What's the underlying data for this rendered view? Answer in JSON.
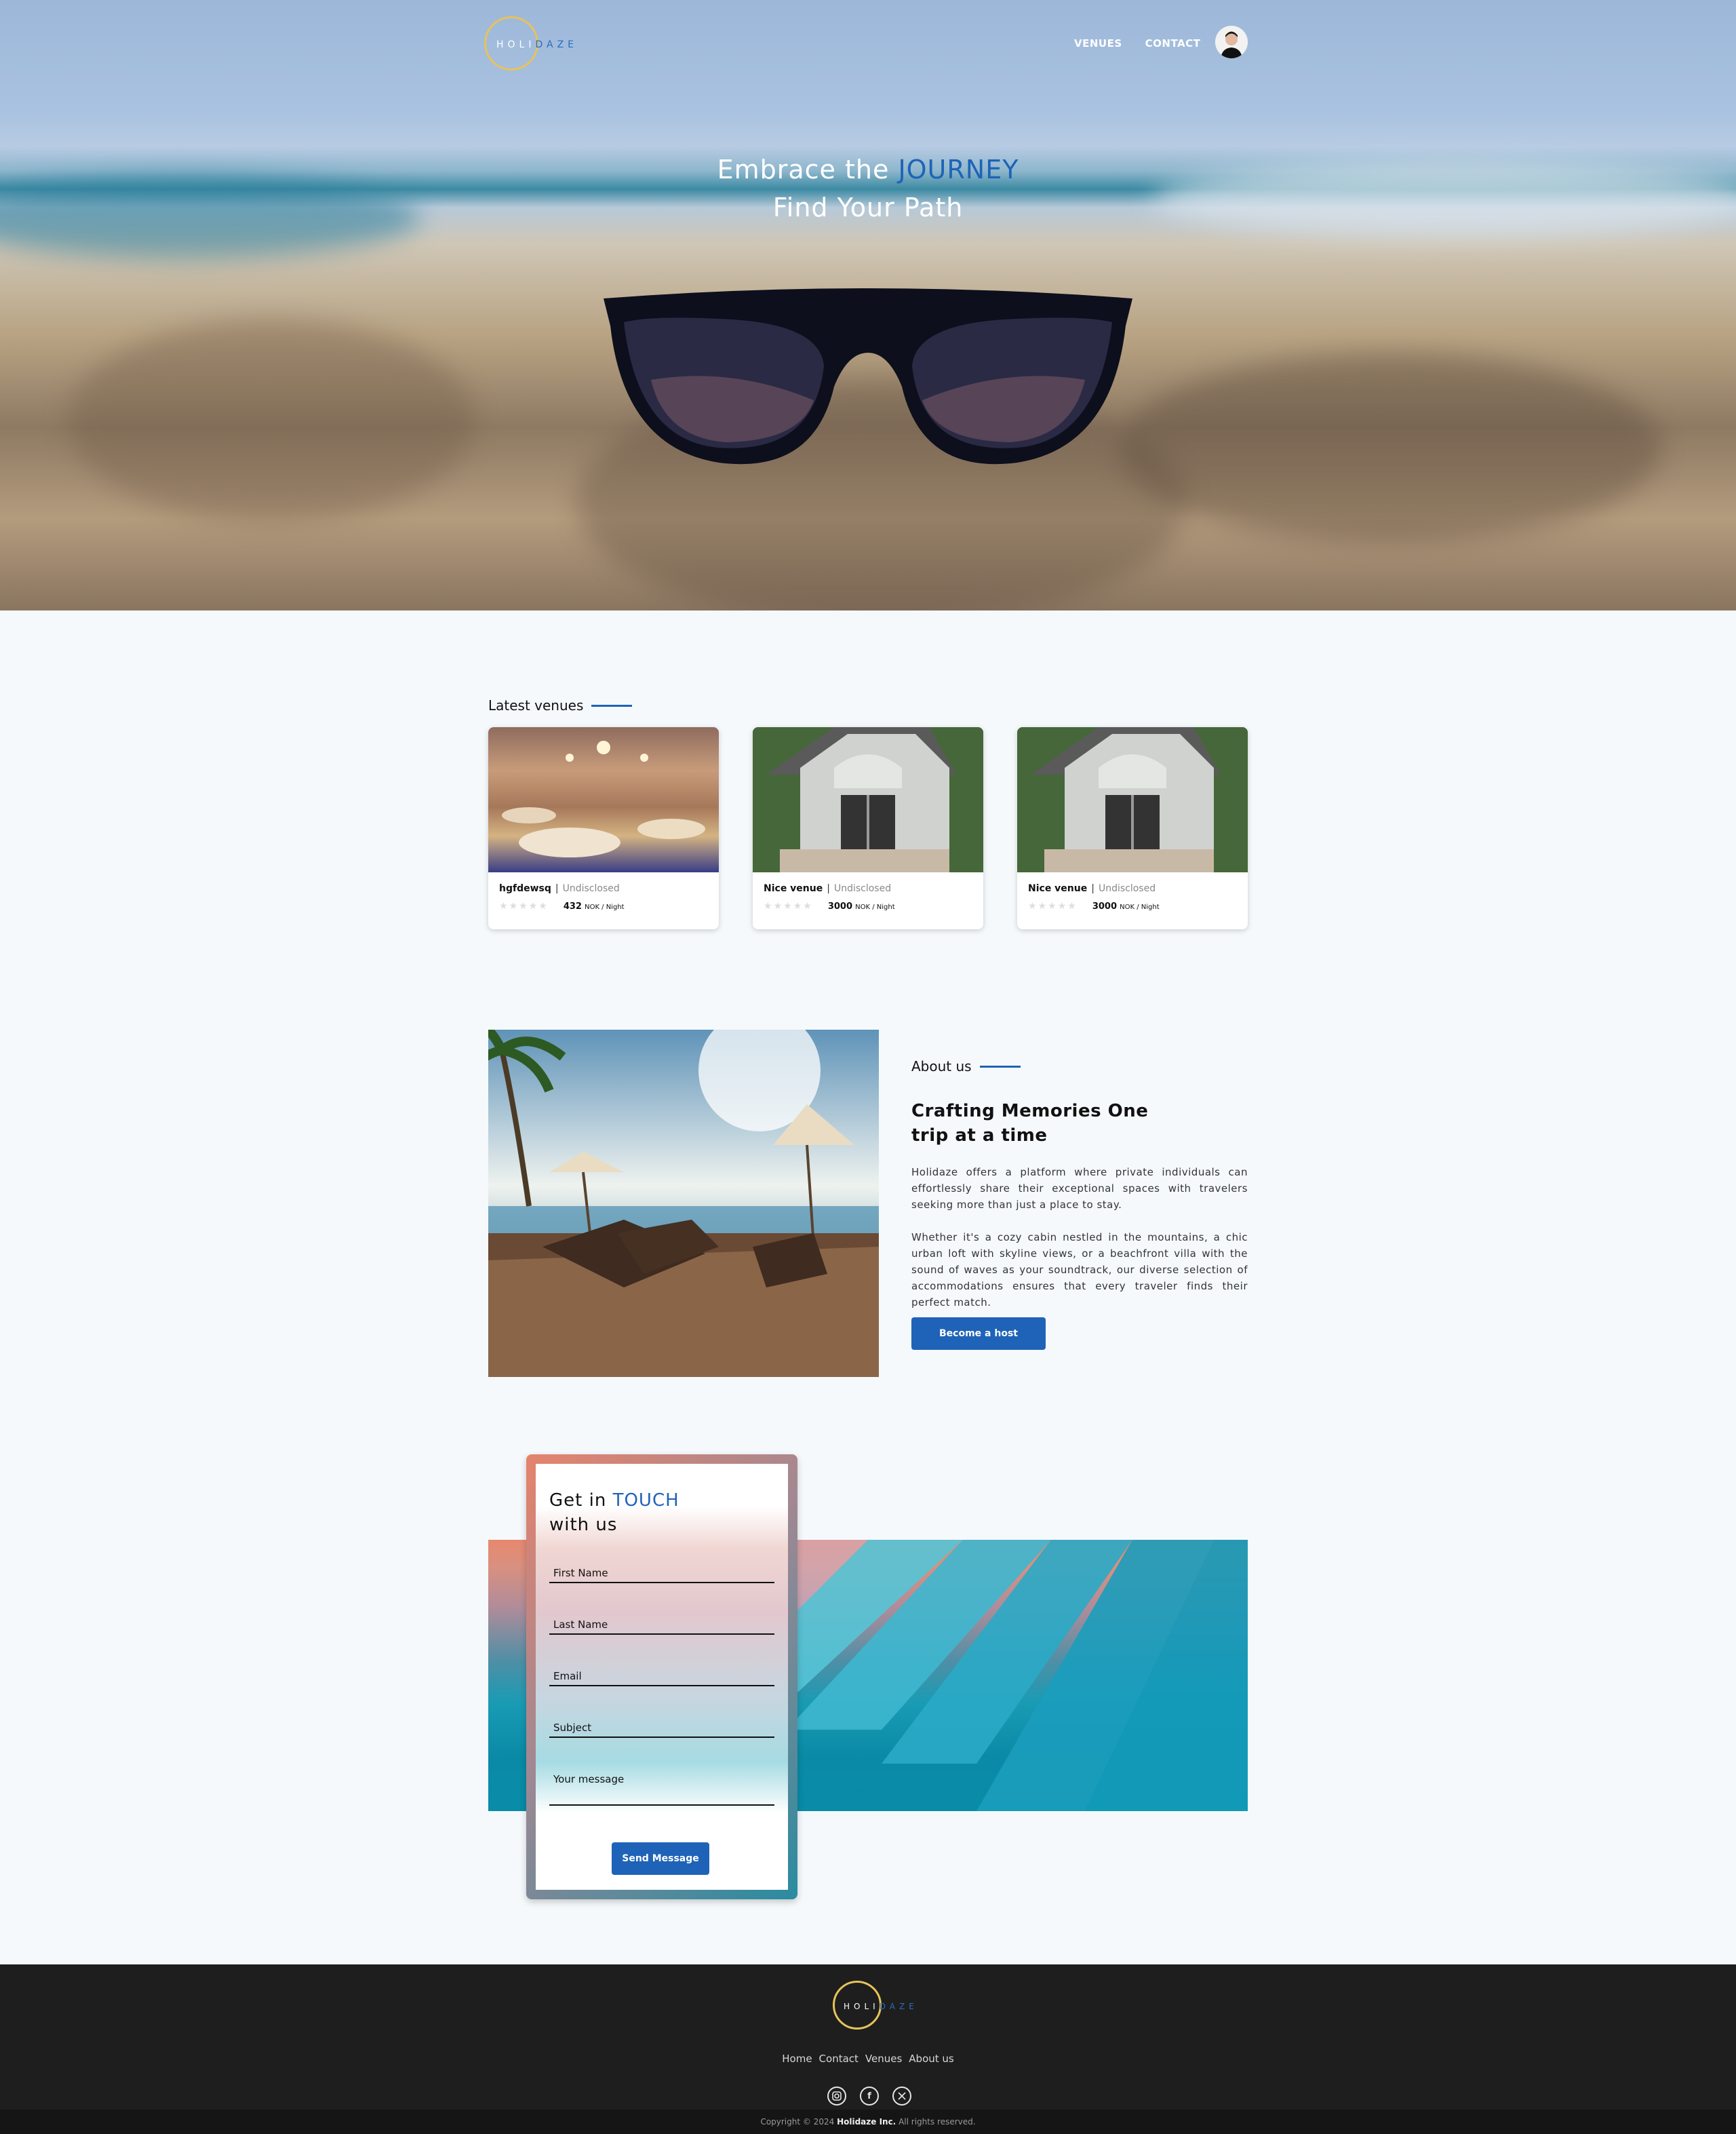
{
  "brand": {
    "logo_left": "HOLI",
    "logo_right": "DAZE"
  },
  "nav": {
    "venues": "VENUES",
    "contact": "CONTACT"
  },
  "hero": {
    "line1_prefix": "Embrace the ",
    "line1_accent": "JOURNEY",
    "line2": "Find Your Path"
  },
  "latest": {
    "heading": "Latest venues",
    "venues": [
      {
        "name": "hgfdewsq",
        "status": "Undisclosed",
        "rating": 0,
        "price": "432",
        "unit": "NOK / Night"
      },
      {
        "name": "Nice venue",
        "status": "Undisclosed",
        "rating": 0,
        "price": "3000",
        "unit": "NOK / Night"
      },
      {
        "name": "Nice venue",
        "status": "Undisclosed",
        "rating": 0,
        "price": "3000",
        "unit": "NOK / Night"
      }
    ]
  },
  "about": {
    "heading": "About us",
    "subheading_line1": "Crafting Memories One",
    "subheading_line2": "trip at a time",
    "p1": "Holidaze offers a platform where private individuals can effortlessly share their exceptional spaces with travelers seeking more than just a place to stay.",
    "p2": "Whether it's a cozy cabin nestled in the mountains, a chic urban loft with skyline views, or a beachfront villa with the sound of waves as your soundtrack, our diverse selection of accommodations ensures that every traveler finds their perfect match.",
    "button": "Become a host"
  },
  "contact": {
    "title_prefix": "Get in ",
    "title_accent": "TOUCH",
    "title_line2": "with us",
    "fields": {
      "first_name": "First Name",
      "last_name": "Last Name",
      "email": "Email",
      "subject": "Subject",
      "message": "Your message"
    },
    "button": "Send Message"
  },
  "footer": {
    "links": [
      "Home",
      "Contact",
      "Venues",
      "About us"
    ],
    "copyright_prefix": "Copyright © 2024 ",
    "copyright_company": "Holidaze Inc.",
    "copyright_suffix": " All rights reserved."
  },
  "colors": {
    "accent": "#1f63b8",
    "logo_ring": "#e6c35a",
    "footer_bg": "#1e1e1e",
    "page_bg": "#f5f9fc"
  },
  "icons": {
    "social": [
      "instagram-icon",
      "facebook-icon",
      "x-icon"
    ],
    "star": "star-icon"
  }
}
